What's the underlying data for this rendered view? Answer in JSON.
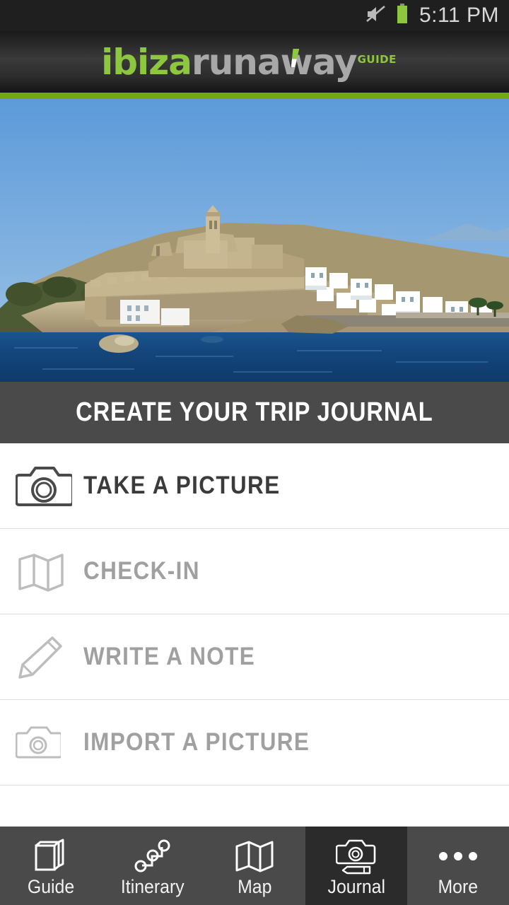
{
  "status_bar": {
    "time": "5:11 PM",
    "icons": [
      "mute-icon",
      "battery-icon"
    ],
    "battery_color": "#8DC63F",
    "background": "#1f1f1f"
  },
  "app_header": {
    "logo_part1": "ibiza",
    "logo_part2": "runaway",
    "logo_superscript": "GUIDE",
    "accent_color": "#8DC63F",
    "accent_bar_color": "#72A811"
  },
  "hero": {
    "alt": "Ibiza Dalt Vila old town fortress above the harbour",
    "sky_color": "#6ba3da",
    "sea_color": "#1b4f86",
    "stone_color": "#c2b08a"
  },
  "banner": {
    "title": "CREATE YOUR TRIP JOURNAL",
    "background": "#4a4a4a"
  },
  "actions": [
    {
      "label": "TAKE A PICTURE",
      "icon": "camera-icon",
      "enabled": true
    },
    {
      "label": "CHECK-IN",
      "icon": "map-fold-icon",
      "enabled": false
    },
    {
      "label": "WRITE A NOTE",
      "icon": "pencil-icon",
      "enabled": false
    },
    {
      "label": "IMPORT A PICTURE",
      "icon": "camera-small-icon",
      "enabled": false
    }
  ],
  "tabbar": {
    "background": "#4a4a4a",
    "active_background": "#2b2b2b",
    "tabs": [
      {
        "label": "Guide",
        "icon": "books-icon",
        "active": false
      },
      {
        "label": "Itinerary",
        "icon": "route-nodes-icon",
        "active": false
      },
      {
        "label": "Map",
        "icon": "map-fold-icon",
        "active": false
      },
      {
        "label": "Journal",
        "icon": "camera-pencil-icon",
        "active": true
      },
      {
        "label": "More",
        "icon": "ellipsis-icon",
        "active": false
      }
    ]
  }
}
